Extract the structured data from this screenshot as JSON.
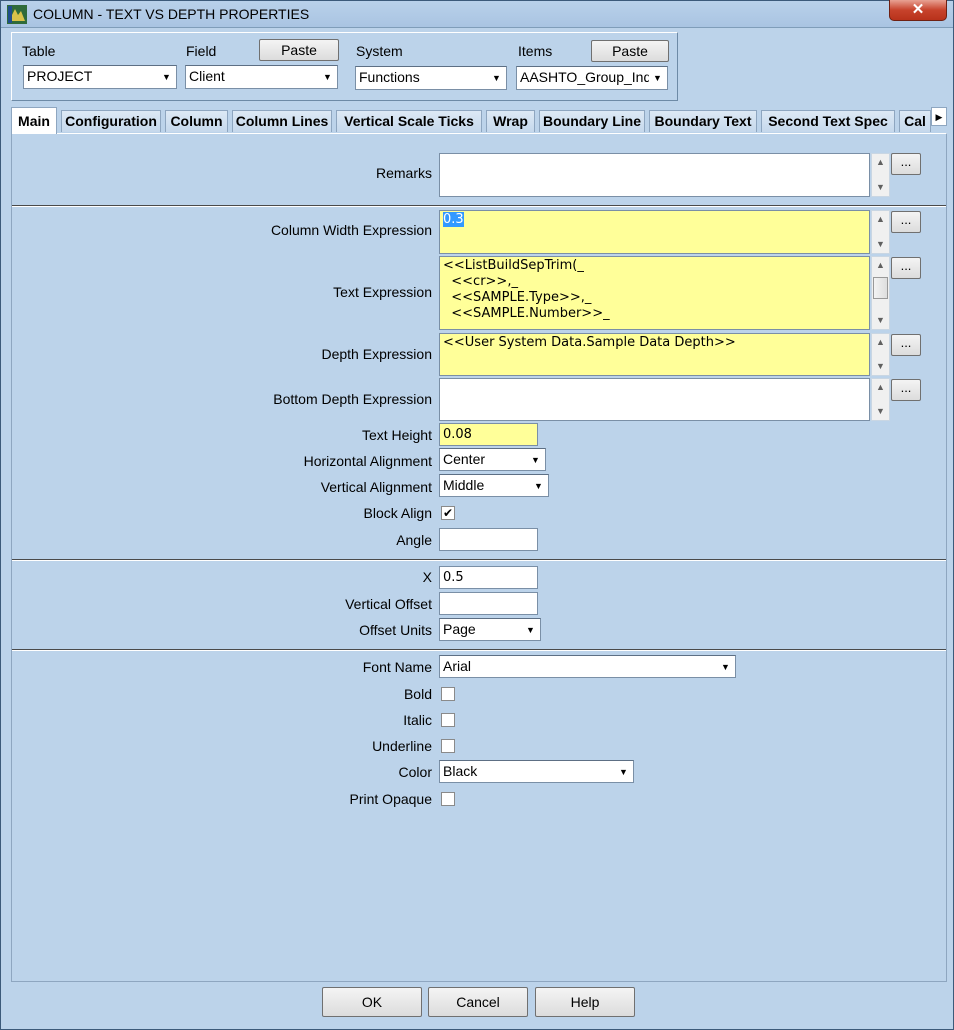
{
  "window": {
    "title": "COLUMN - TEXT VS DEPTH PROPERTIES",
    "close_label": "✕"
  },
  "header": {
    "table_label": "Table",
    "table_value": "PROJECT",
    "field_label": "Field",
    "field_value": "Client",
    "field_paste": "Paste",
    "system_label": "System",
    "system_value": "Functions",
    "items_label": "Items",
    "items_value": "AASHTO_Group_Inde",
    "items_paste": "Paste"
  },
  "tabs": [
    "Main",
    "Configuration",
    "Column",
    "Column Lines",
    "Vertical Scale Ticks",
    "Wrap",
    "Boundary Line",
    "Boundary Text",
    "Second Text Spec",
    "Cal"
  ],
  "form": {
    "remarks_label": "Remarks",
    "remarks_value": "",
    "column_width_label": "Column Width Expression",
    "column_width_value": "0.3",
    "text_expr_label": "Text Expression",
    "text_expr_value": "<<ListBuildSepTrim(_\n  <<cr>>,_\n  <<SAMPLE.Type>>,_\n  <<SAMPLE.Number>>_",
    "depth_expr_label": "Depth Expression",
    "depth_expr_value": "<<User System Data.Sample Data Depth>>",
    "bottom_depth_label": "Bottom Depth Expression",
    "bottom_depth_value": "",
    "text_height_label": "Text Height",
    "text_height_value": "0.08",
    "horiz_align_label": "Horizontal Alignment",
    "horiz_align_value": "Center",
    "vert_align_label": "Vertical Alignment",
    "vert_align_value": "Middle",
    "block_align_label": "Block Align",
    "angle_label": "Angle",
    "angle_value": "",
    "x_label": "X",
    "x_value": "0.5",
    "vert_offset_label": "Vertical Offset",
    "vert_offset_value": "",
    "offset_units_label": "Offset Units",
    "offset_units_value": "Page",
    "font_name_label": "Font Name",
    "font_name_value": "Arial",
    "bold_label": "Bold",
    "italic_label": "Italic",
    "underline_label": "Underline",
    "color_label": "Color",
    "color_value": "Black",
    "print_opaque_label": "Print Opaque",
    "dots_label": "..."
  },
  "buttons": {
    "ok": "OK",
    "cancel": "Cancel",
    "help": "Help"
  },
  "colors": {
    "panel": "#bcd3ea",
    "yellow_field": "#ffff99",
    "close": "#c7432c"
  }
}
